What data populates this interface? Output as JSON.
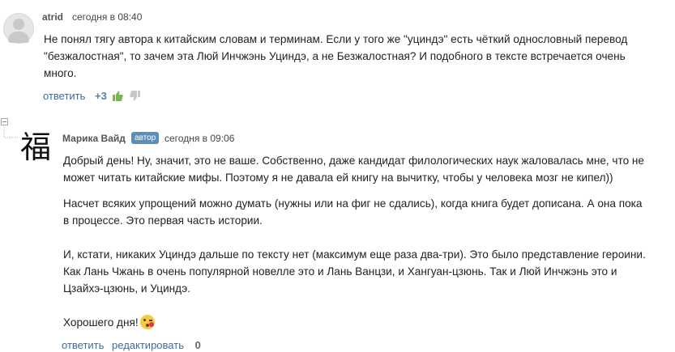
{
  "comments": [
    {
      "author": "atrid",
      "time": "сегодня в 08:40",
      "lines": [
        "Не понял тягу автора к китайским словам и терминам. Если у того же \"уциндэ\" есть чёткий однословный перевод",
        "\"безжалостная\", то зачем эта Люй Инчжэнь Уциндэ, а не Безжалостная? И подобного в тексте встречается очень",
        "много."
      ],
      "reply_label": "ответить",
      "score": "+3",
      "like_icon": "thumbs-up-icon",
      "dislike_icon": "thumbs-down-icon"
    },
    {
      "author": "Марика Вайд",
      "badge": "автор",
      "time": "сегодня в 09:06",
      "avatar_glyph": "福",
      "para1": [
        "Добрый день! Ну, значит, это не ваше. Собственно, даже кандидат филологических наук жаловалась мне, что не",
        "может читать китайские мифы. Поэтому я не давала ей книгу на вычитку, чтобы у человека мозг не кипел))"
      ],
      "para2": [
        "Насчет всяких упрощений можно думать (нужны или на фиг не сдались), когда книга будет дописана. А она пока",
        "в процессе. Это первая часть истории."
      ],
      "para3": [
        "И, кстати, никаких Уциндэ дальше по тексту нет (максимум еще раза два-три). Это было представление героини.",
        "Как Лань Чжань в очень популярной новелле это и Лань Ванцзи, и Хангуан-цзюнь. Так и Люй Инчжэнь это и",
        "Цзайхэ-цзюнь, и Уциндэ."
      ],
      "closing": "Хорошего дня!",
      "emoji": "kiss-emoji-icon",
      "reply_label": "ответить",
      "edit_label": "редактировать",
      "score": "0"
    }
  ],
  "colors": {
    "link": "#3b6e9b",
    "badge": "#5b8fb9",
    "like": "#7bb84b"
  }
}
